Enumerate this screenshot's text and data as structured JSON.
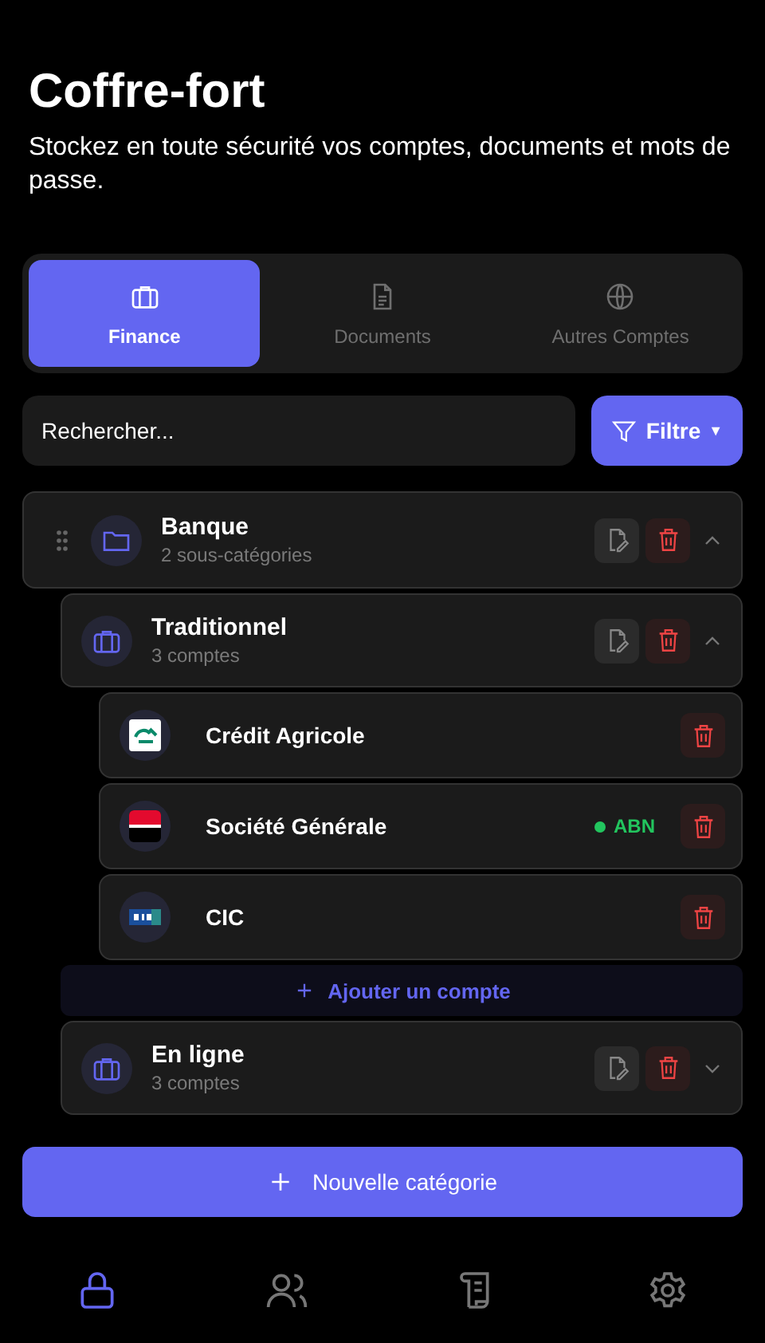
{
  "header": {
    "title": "Coffre-fort",
    "subtitle": "Stockez en toute sécurité vos comptes, documents et mots de passe."
  },
  "tabs": [
    {
      "label": "Finance",
      "kind": "finance",
      "selected": true
    },
    {
      "label": "Documents",
      "kind": "documents",
      "selected": false
    },
    {
      "label": "Autres Comptes",
      "kind": "other",
      "selected": false
    }
  ],
  "search": {
    "placeholder": "Rechercher..."
  },
  "filter_button": {
    "label": "Filtre",
    "caret": "▼"
  },
  "categories": [
    {
      "name": "Banque",
      "subtitle": "2 sous-catégories",
      "kind": "folder",
      "expanded": true,
      "children": [
        {
          "name": "Traditionnel",
          "subtitle": "3 comptes",
          "kind": "briefcase",
          "expanded": true,
          "accounts": [
            {
              "name": "Crédit Agricole",
              "kind": "green-mark"
            },
            {
              "name": "Société Générale",
              "kind": "flag",
              "status": {
                "label": "ABN",
                "color": "#22c55e"
              }
            },
            {
              "name": "CIC",
              "kind": "blue-tag"
            }
          ],
          "add_label": "Ajouter un compte"
        },
        {
          "name": "En ligne",
          "subtitle": "3 comptes",
          "kind": "briefcase",
          "expanded": false
        }
      ]
    }
  ],
  "new_category": "Nouvelle catégorie",
  "bottom_nav": [
    {
      "kind": "lock",
      "selected": true
    },
    {
      "kind": "people",
      "selected": false
    },
    {
      "kind": "scroll",
      "selected": false
    },
    {
      "kind": "gear",
      "selected": false
    }
  ]
}
